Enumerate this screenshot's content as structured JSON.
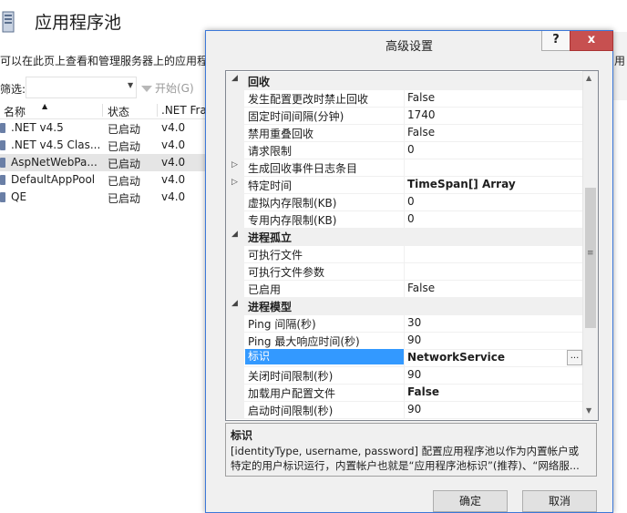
{
  "background": {
    "title": "应用程序池",
    "description": "可以在此页上查看和管理服务器上的应用程",
    "description_right": "用",
    "filter_label": "筛选:",
    "start_label": "开始(G)",
    "columns": [
      "名称",
      "状态",
      ".NET Fra"
    ],
    "pools": [
      {
        "name": ".NET v4.5",
        "status": "已启动",
        "clr": "v4.0"
      },
      {
        "name": ".NET v4.5 Clas...",
        "status": "已启动",
        "clr": "v4.0"
      },
      {
        "name": "AspNetWebPa...",
        "status": "已启动",
        "clr": "v4.0"
      },
      {
        "name": "DefaultAppPool",
        "status": "已启动",
        "clr": "v4.0"
      },
      {
        "name": "QE",
        "status": "已启动",
        "clr": "v4.0"
      }
    ]
  },
  "dialog": {
    "title": "高级设置",
    "help_label": "?",
    "close_label": "x",
    "properties": [
      {
        "kind": "category",
        "expander": "◢",
        "name": "回收",
        "value": ""
      },
      {
        "kind": "item",
        "expander": "",
        "name": "发生配置更改时禁止回收",
        "value": "False"
      },
      {
        "kind": "item",
        "expander": "",
        "name": "固定时间间隔(分钟)",
        "value": "1740"
      },
      {
        "kind": "item",
        "expander": "",
        "name": "禁用重叠回收",
        "value": "False"
      },
      {
        "kind": "item",
        "expander": "",
        "name": "请求限制",
        "value": "0"
      },
      {
        "kind": "item",
        "expander": "▷",
        "name": "生成回收事件日志条目",
        "value": ""
      },
      {
        "kind": "item-bold",
        "expander": "▷",
        "name": "特定时间",
        "value": "TimeSpan[] Array"
      },
      {
        "kind": "item",
        "expander": "",
        "name": "虚拟内存限制(KB)",
        "value": "0"
      },
      {
        "kind": "item",
        "expander": "",
        "name": "专用内存限制(KB)",
        "value": "0"
      },
      {
        "kind": "category",
        "expander": "◢",
        "name": "进程孤立",
        "value": ""
      },
      {
        "kind": "item",
        "expander": "",
        "name": "可执行文件",
        "value": ""
      },
      {
        "kind": "item",
        "expander": "",
        "name": "可执行文件参数",
        "value": ""
      },
      {
        "kind": "item",
        "expander": "",
        "name": "已启用",
        "value": "False"
      },
      {
        "kind": "category",
        "expander": "◢",
        "name": "进程模型",
        "value": ""
      },
      {
        "kind": "item",
        "expander": "",
        "name": "Ping 间隔(秒)",
        "value": "30"
      },
      {
        "kind": "item",
        "expander": "",
        "name": "Ping 最大响应时间(秒)",
        "value": "90"
      },
      {
        "kind": "selected",
        "expander": "",
        "name": "标识",
        "value": "NetworkService"
      },
      {
        "kind": "item",
        "expander": "",
        "name": "关闭时间限制(秒)",
        "value": "90"
      },
      {
        "kind": "item-bold",
        "expander": "",
        "name": "加载用户配置文件",
        "value": "False"
      },
      {
        "kind": "item",
        "expander": "",
        "name": "启动时间限制(秒)",
        "value": "90"
      }
    ],
    "ellipsis_label": "...",
    "description": {
      "title": "标识",
      "line1": "[identityType, username, password] 配置应用程序池以作为内置帐户或",
      "line2": "特定的用户标识运行，内置帐户也就是“应用程序池标识”(推荐)、“网络服..."
    },
    "ok_label": "确定",
    "cancel_label": "取消"
  }
}
